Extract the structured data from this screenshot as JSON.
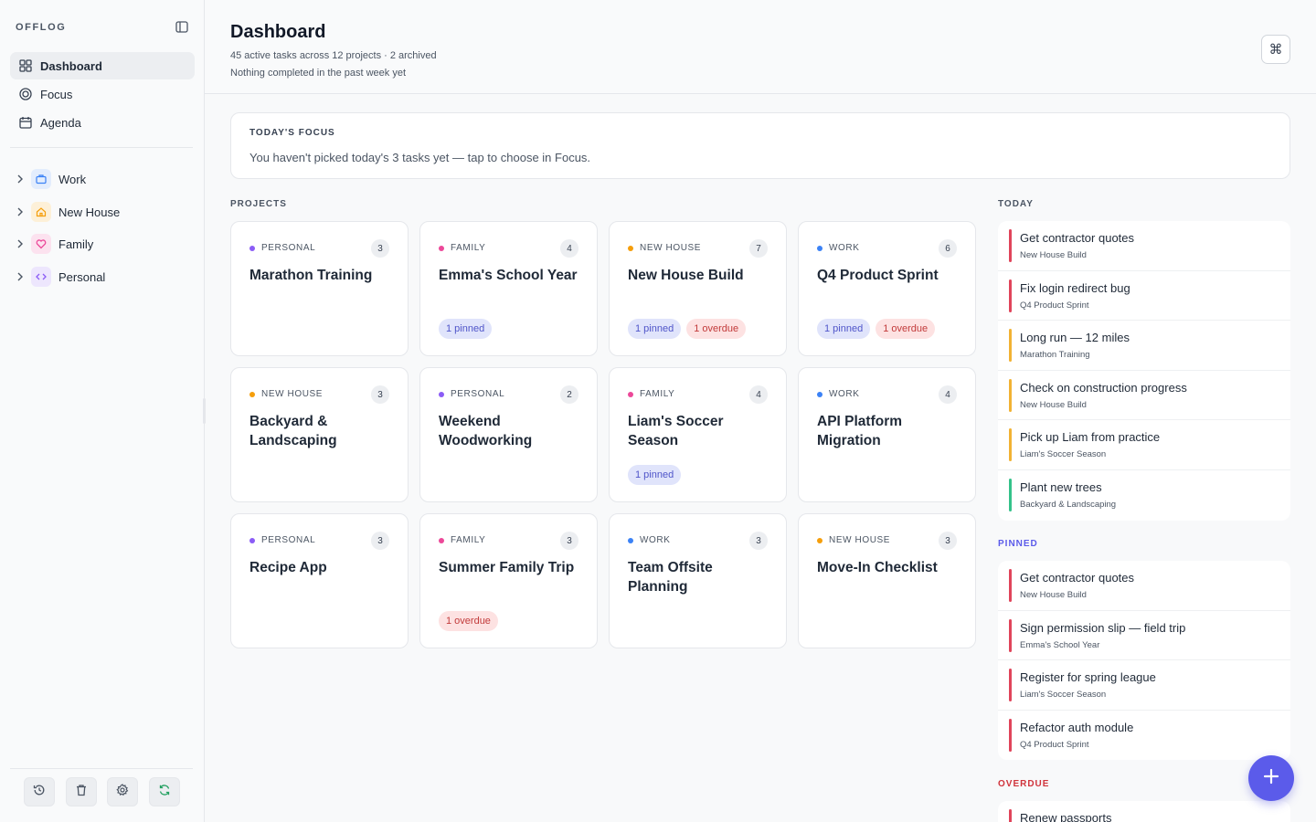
{
  "sidebar": {
    "brand": "OFFLOG",
    "nav": [
      {
        "label": "Dashboard",
        "icon": "grid-icon",
        "active": true
      },
      {
        "label": "Focus",
        "icon": "target-icon",
        "active": false
      },
      {
        "label": "Agenda",
        "icon": "calendar-icon",
        "active": false
      }
    ],
    "areas": [
      {
        "label": "Work",
        "icon": "briefcase-icon",
        "color": "#3b82f6",
        "bg": "#e3edfd"
      },
      {
        "label": "New House",
        "icon": "house-icon",
        "color": "#f59e0b",
        "bg": "#fdf0d8"
      },
      {
        "label": "Family",
        "icon": "heart-icon",
        "color": "#ec4899",
        "bg": "#fce2ef"
      },
      {
        "label": "Personal",
        "icon": "code-icon",
        "color": "#8b5cf6",
        "bg": "#ede6fd"
      }
    ],
    "tools": [
      "history-icon",
      "trash-icon",
      "settings-icon",
      "sync-icon"
    ]
  },
  "header": {
    "title": "Dashboard",
    "subtitle": "45 active tasks across 12 projects · 2 archived",
    "subtitle2": "Nothing completed in the past week yet",
    "command_glyph": "⌘"
  },
  "focus": {
    "title": "TODAY'S FOCUS",
    "text": "You haven't picked today's 3 tasks yet — tap to choose in Focus."
  },
  "projects_label": "PROJECTS",
  "colors": {
    "personal": "#8b5cf6",
    "family": "#ec4899",
    "new_house": "#f59e0b",
    "work": "#3b82f6",
    "accent": "#5b5bea"
  },
  "projects": [
    {
      "category": "PERSONAL",
      "color": "#8b5cf6",
      "count": "3",
      "name": "Marathon Training",
      "tags": []
    },
    {
      "category": "FAMILY",
      "color": "#ec4899",
      "count": "4",
      "name": "Emma's School Year",
      "tags": [
        {
          "type": "pinned",
          "label": "1 pinned"
        }
      ]
    },
    {
      "category": "NEW HOUSE",
      "color": "#f59e0b",
      "count": "7",
      "name": "New House Build",
      "tags": [
        {
          "type": "pinned",
          "label": "1 pinned"
        },
        {
          "type": "overdue",
          "label": "1 overdue"
        }
      ]
    },
    {
      "category": "WORK",
      "color": "#3b82f6",
      "count": "6",
      "name": "Q4 Product Sprint",
      "tags": [
        {
          "type": "pinned",
          "label": "1 pinned"
        },
        {
          "type": "overdue",
          "label": "1 overdue"
        }
      ]
    },
    {
      "category": "NEW HOUSE",
      "color": "#f59e0b",
      "count": "3",
      "name": "Backyard & Landscaping",
      "tags": []
    },
    {
      "category": "PERSONAL",
      "color": "#8b5cf6",
      "count": "2",
      "name": "Weekend Woodworking",
      "tags": []
    },
    {
      "category": "FAMILY",
      "color": "#ec4899",
      "count": "4",
      "name": "Liam's Soccer Season",
      "tags": [
        {
          "type": "pinned",
          "label": "1 pinned"
        }
      ]
    },
    {
      "category": "WORK",
      "color": "#3b82f6",
      "count": "4",
      "name": "API Platform Migration",
      "tags": []
    },
    {
      "category": "PERSONAL",
      "color": "#8b5cf6",
      "count": "3",
      "name": "Recipe App",
      "tags": []
    },
    {
      "category": "FAMILY",
      "color": "#ec4899",
      "count": "3",
      "name": "Summer Family Trip",
      "tags": [
        {
          "type": "overdue",
          "label": "1 overdue"
        }
      ]
    },
    {
      "category": "WORK",
      "color": "#3b82f6",
      "count": "3",
      "name": "Team Offsite Planning",
      "tags": []
    },
    {
      "category": "NEW HOUSE",
      "color": "#f59e0b",
      "count": "3",
      "name": "Move-In Checklist",
      "tags": []
    }
  ],
  "today": {
    "label": "TODAY",
    "label_color": "#4b5563",
    "tasks": [
      {
        "title": "Get contractor quotes",
        "project": "New House Build",
        "color": "#e0445a"
      },
      {
        "title": "Fix login redirect bug",
        "project": "Q4 Product Sprint",
        "color": "#e0445a"
      },
      {
        "title": "Long run — 12 miles",
        "project": "Marathon Training",
        "color": "#f2b233"
      },
      {
        "title": "Check on construction progress",
        "project": "New House Build",
        "color": "#f2b233"
      },
      {
        "title": "Pick up Liam from practice",
        "project": "Liam's Soccer Season",
        "color": "#f2b233"
      },
      {
        "title": "Plant new trees",
        "project": "Backyard & Landscaping",
        "color": "#34c28a"
      }
    ]
  },
  "pinned": {
    "label": "PINNED",
    "label_color": "#5b5bea",
    "tasks": [
      {
        "title": "Get contractor quotes",
        "project": "New House Build",
        "color": "#e0445a"
      },
      {
        "title": "Sign permission slip — field trip",
        "project": "Emma's School Year",
        "color": "#e0445a"
      },
      {
        "title": "Register for spring league",
        "project": "Liam's Soccer Season",
        "color": "#e0445a"
      },
      {
        "title": "Refactor auth module",
        "project": "Q4 Product Sprint",
        "color": "#e0445a"
      }
    ]
  },
  "overdue": {
    "label": "OVERDUE",
    "label_color": "#d0333b",
    "tasks": [
      {
        "title": "Renew passports",
        "project": "",
        "color": "#e0445a"
      }
    ]
  }
}
